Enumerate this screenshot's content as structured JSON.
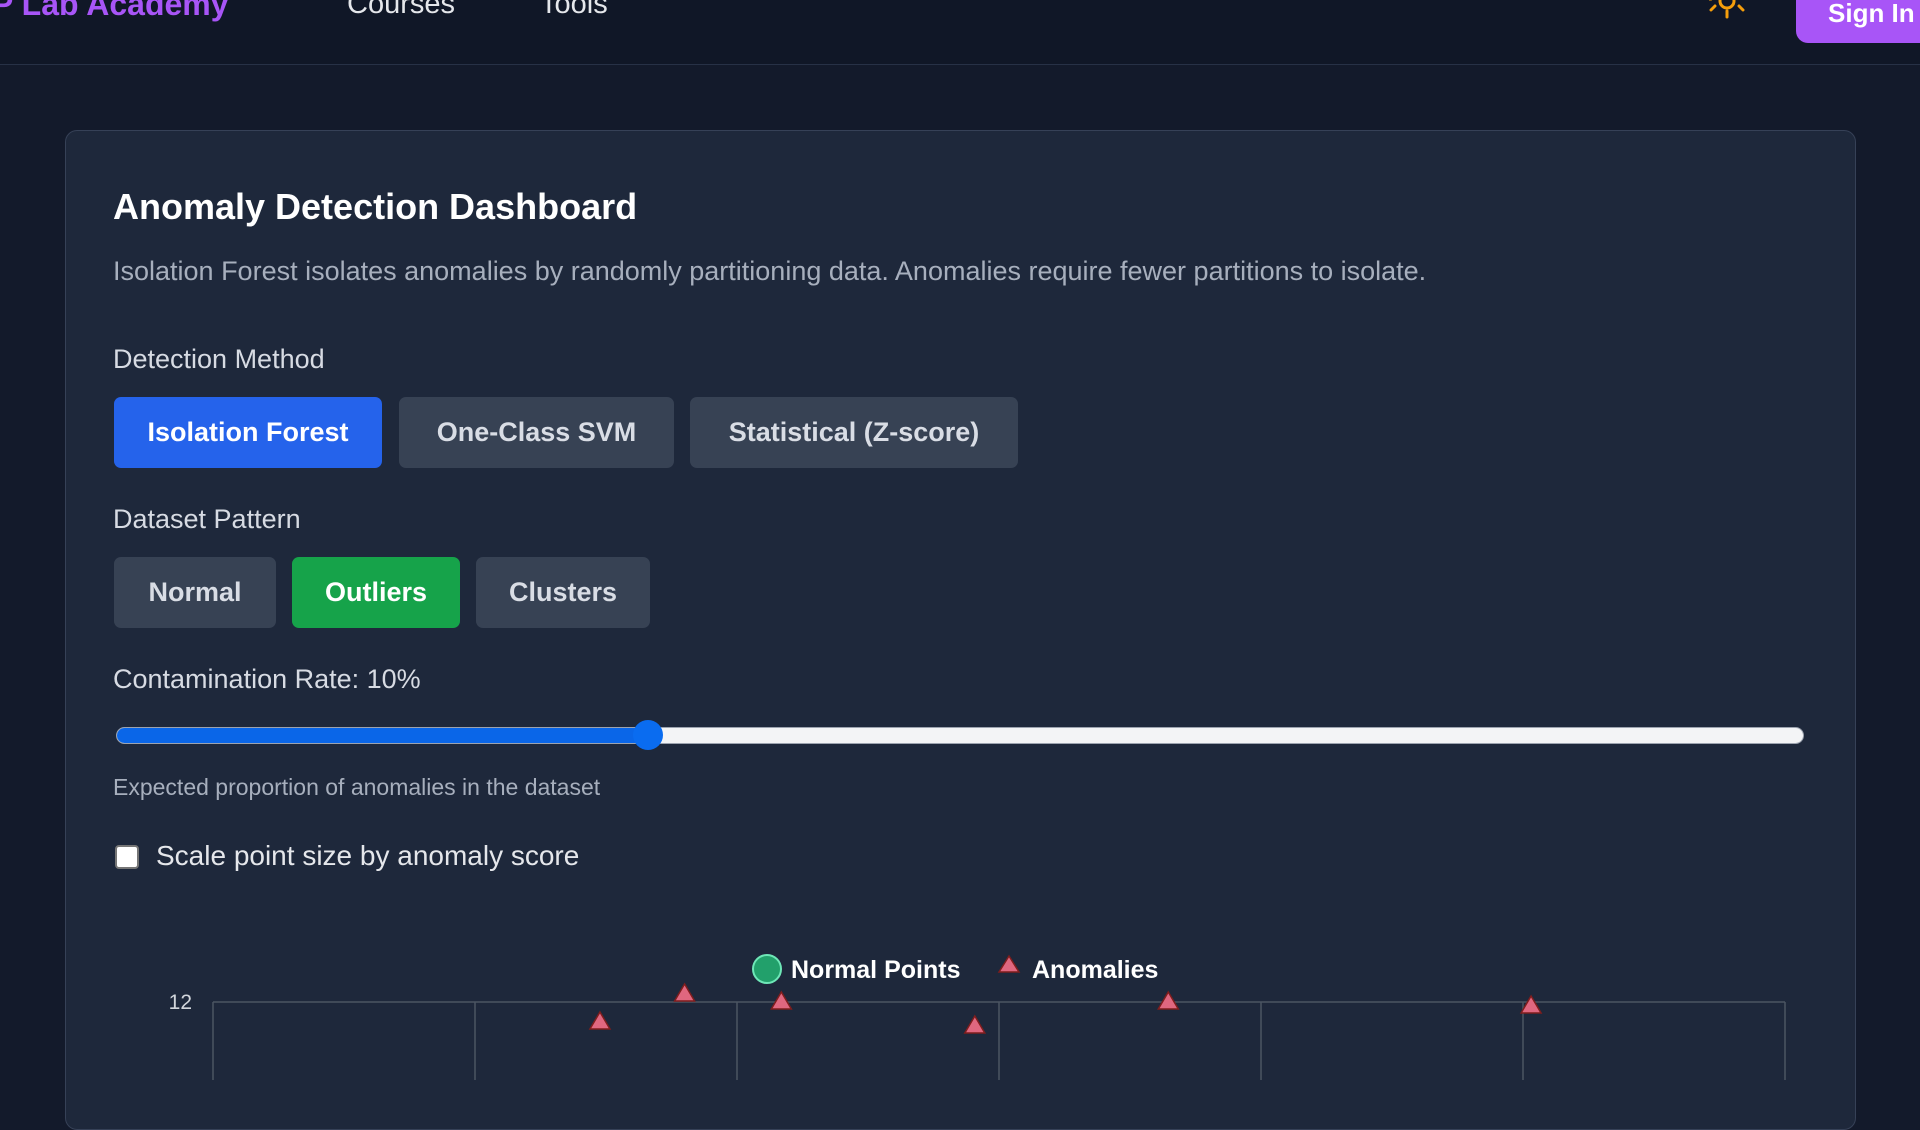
{
  "header": {
    "brand": "P Lab Academy",
    "nav": [
      "Courses",
      "Tools"
    ],
    "theme_icon": "sun-icon",
    "signin_label": "Sign In"
  },
  "dashboard": {
    "title": "Anomaly Detection Dashboard",
    "description": "Isolation Forest isolates anomalies by randomly partitioning data. Anomalies require fewer partitions to isolate.",
    "method_label": "Detection Method",
    "methods": [
      "Isolation Forest",
      "One-Class SVM",
      "Statistical (Z-score)"
    ],
    "selected_method": "Isolation Forest",
    "pattern_label": "Dataset Pattern",
    "patterns": [
      "Normal",
      "Outliers",
      "Clusters"
    ],
    "selected_pattern": "Outliers",
    "contamination_label": "Contamination Rate: 10%",
    "contamination_value": 10,
    "contamination_slider_fraction": 0.315,
    "contamination_hint": "Expected proportion of anomalies in the dataset",
    "scale_checkbox_label": "Scale point size by anomaly score",
    "scale_checked": false
  },
  "colors": {
    "accent_purple": "#a855f7",
    "active_blue": "#2563eb",
    "active_green": "#16a34a",
    "normal_point": "#22a06b",
    "anomaly_point": "#e0677f"
  },
  "chart_data": {
    "type": "scatter",
    "legend": [
      "Normal Points",
      "Anomalies"
    ],
    "legend_placement": "top-center",
    "y_tick_visible": "12",
    "series": [
      {
        "name": "Anomalies",
        "points": [
          {
            "x": 3.2,
            "y": 11.5
          },
          {
            "x": 3.9,
            "y": 12.2
          },
          {
            "x": 4.7,
            "y": 12.0
          },
          {
            "x": 6.3,
            "y": 11.4
          },
          {
            "x": 7.9,
            "y": 12.0
          },
          {
            "x": 10.9,
            "y": 11.9
          }
        ]
      },
      {
        "name": "Normal Points",
        "points": []
      }
    ],
    "xlim": [
      0,
      13
    ],
    "grid": true
  }
}
